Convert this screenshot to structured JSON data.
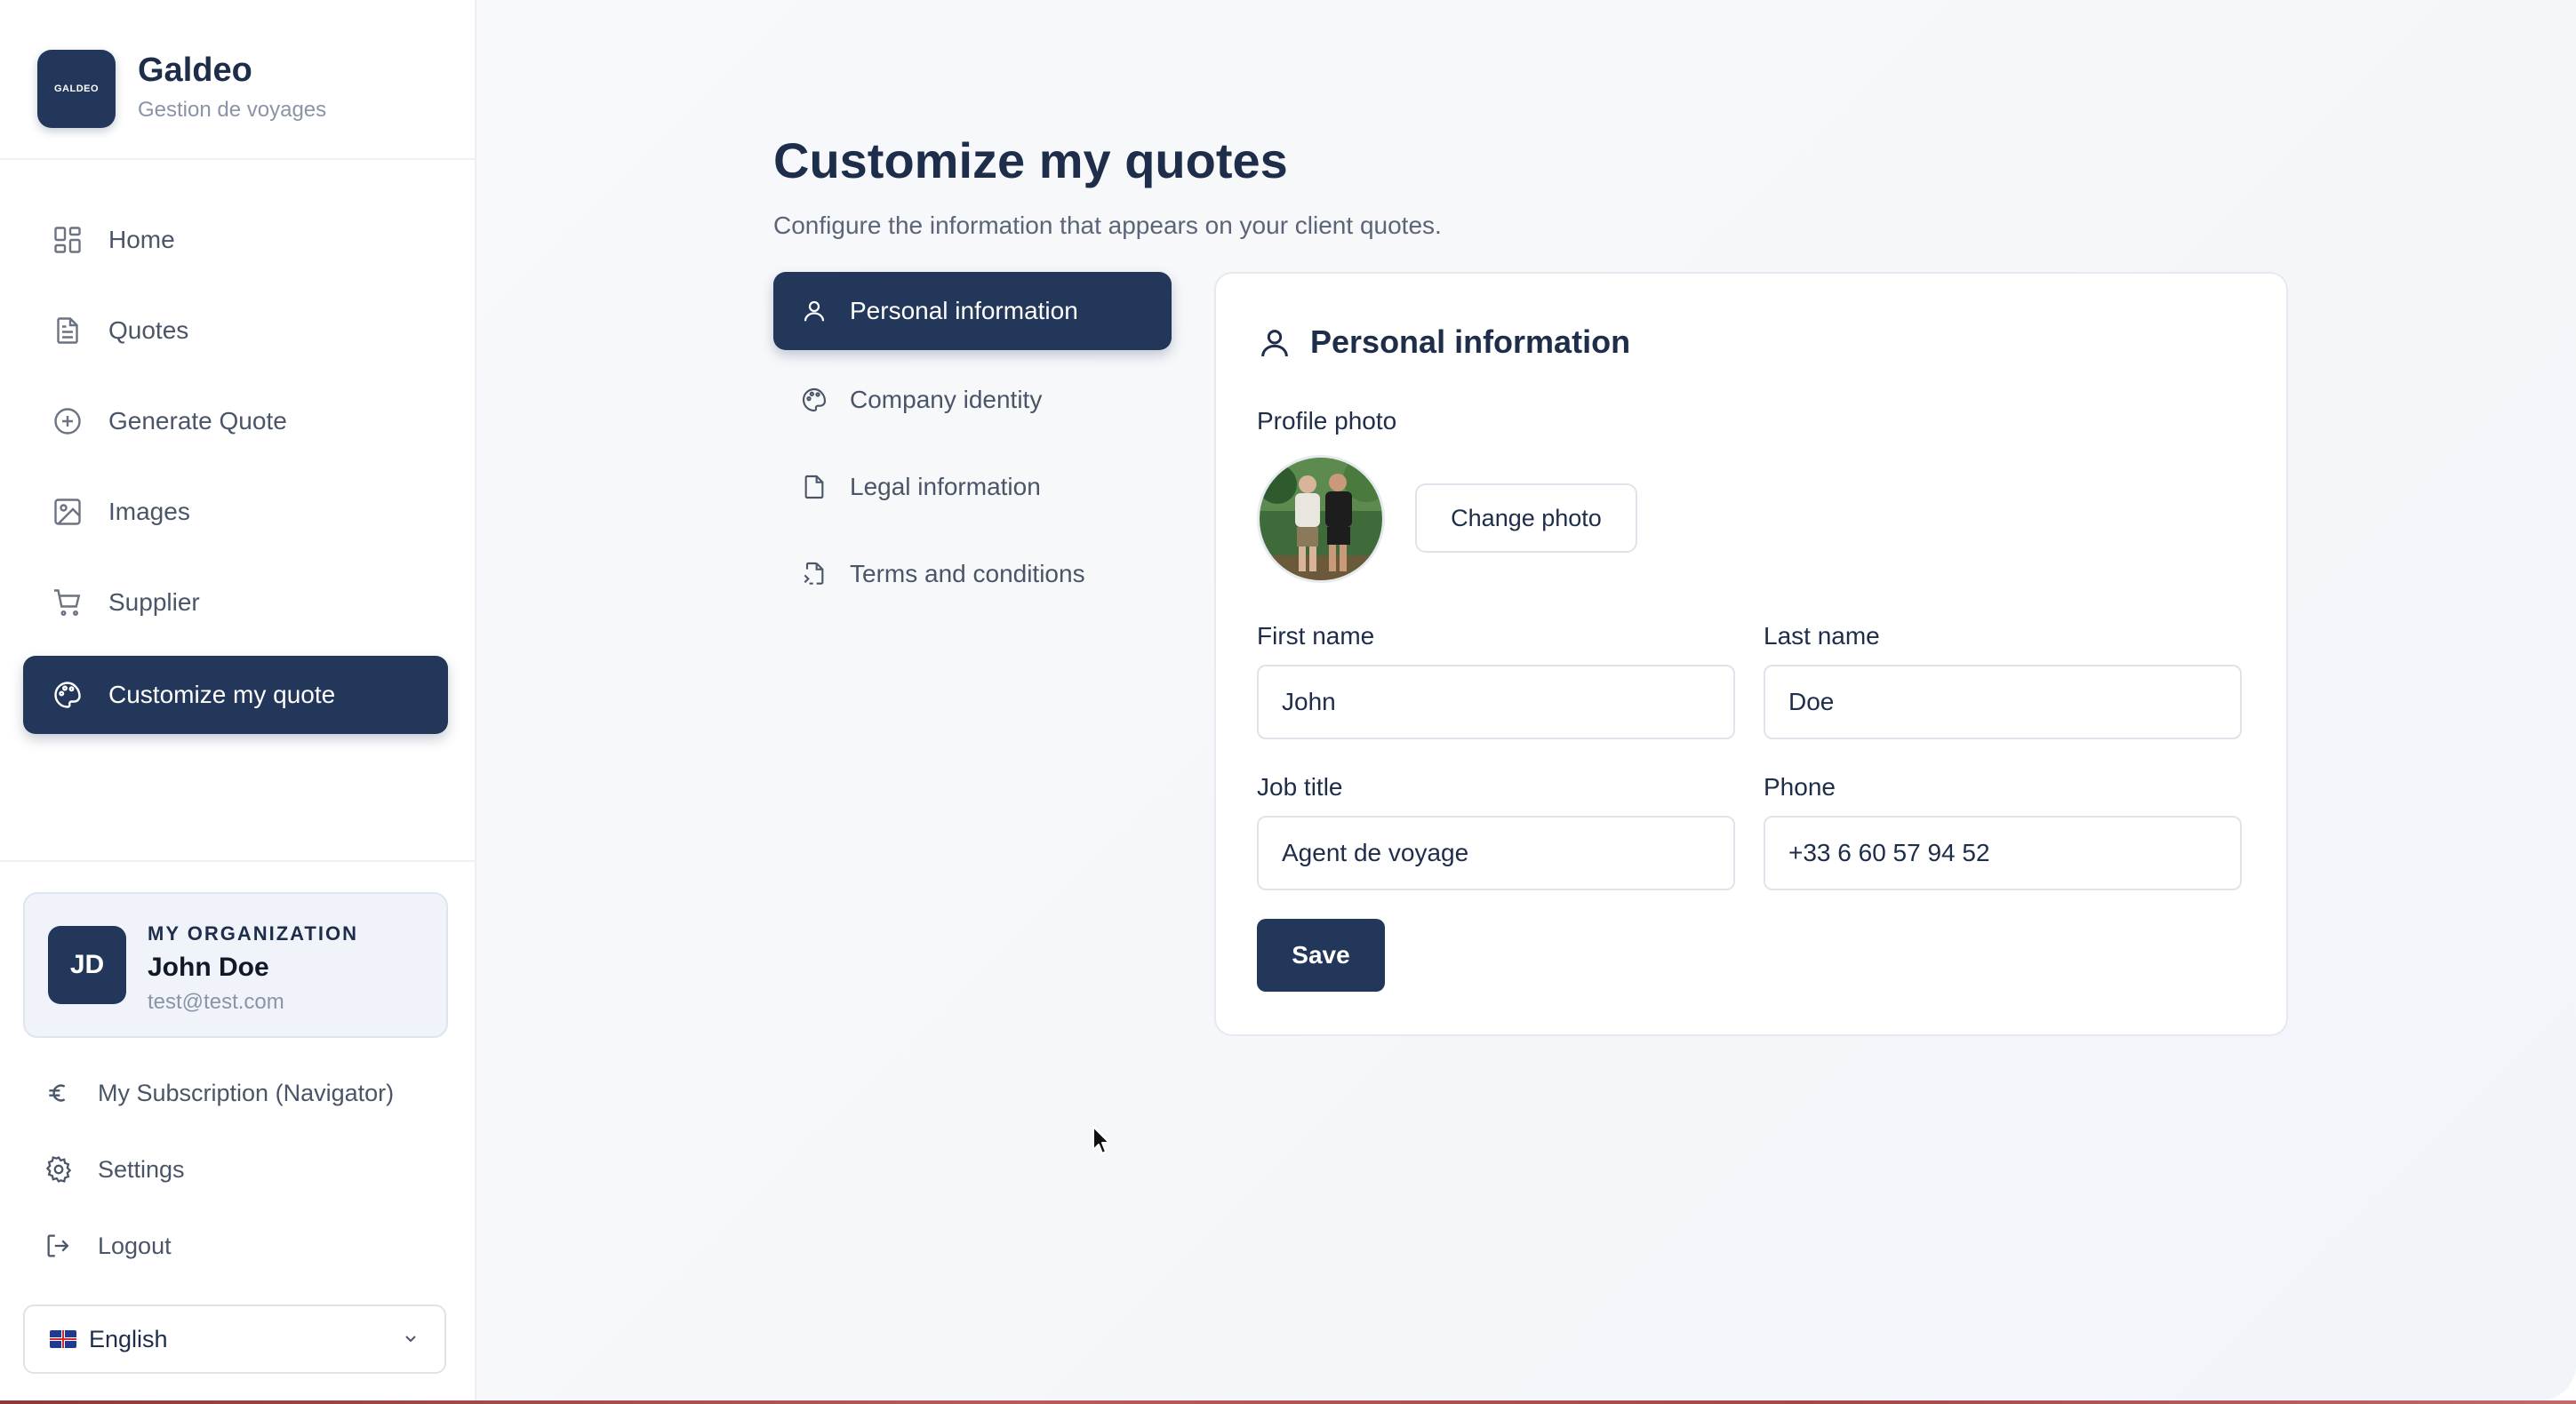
{
  "brand": {
    "logo_text": "GALDEO",
    "name": "Galdeo",
    "subtitle": "Gestion de voyages"
  },
  "sidebar": {
    "items": [
      {
        "label": "Home",
        "icon": "grid-icon"
      },
      {
        "label": "Quotes",
        "icon": "document-icon"
      },
      {
        "label": "Generate Quote",
        "icon": "plus-circle-icon"
      },
      {
        "label": "Images",
        "icon": "image-icon"
      },
      {
        "label": "Supplier",
        "icon": "cart-icon"
      },
      {
        "label": "Customize my quote",
        "icon": "palette-icon",
        "active": true
      }
    ],
    "organization": {
      "label": "MY ORGANIZATION",
      "initials": "JD",
      "name": "John Doe",
      "email": "test@test.com"
    },
    "footer_links": [
      {
        "label": "My Subscription (Navigator)",
        "icon": "euro-icon"
      },
      {
        "label": "Settings",
        "icon": "gear-icon"
      },
      {
        "label": "Logout",
        "icon": "logout-icon"
      }
    ],
    "language": {
      "selected": "English",
      "flag": "uk-flag-icon"
    }
  },
  "page": {
    "title": "Customize my quotes",
    "subtitle": "Configure the information that appears on your client quotes."
  },
  "subnav": {
    "items": [
      {
        "label": "Personal information",
        "icon": "user-icon",
        "active": true
      },
      {
        "label": "Company identity",
        "icon": "palette-icon"
      },
      {
        "label": "Legal information",
        "icon": "file-icon"
      },
      {
        "label": "Terms and conditions",
        "icon": "file-signature-icon"
      }
    ]
  },
  "form": {
    "title": "Personal information",
    "profile_photo_label": "Profile photo",
    "change_photo_label": "Change photo",
    "first_name": {
      "label": "First name",
      "value": "John"
    },
    "last_name": {
      "label": "Last name",
      "value": "Doe"
    },
    "job_title": {
      "label": "Job title",
      "value": "Agent de voyage"
    },
    "phone": {
      "label": "Phone",
      "value": "+33 6 60 57 94 52"
    },
    "save_label": "Save"
  },
  "colors": {
    "primary": "#23375a",
    "text": "#1e2d4a",
    "muted": "#8a94a6",
    "border": "#dfe3ea"
  }
}
